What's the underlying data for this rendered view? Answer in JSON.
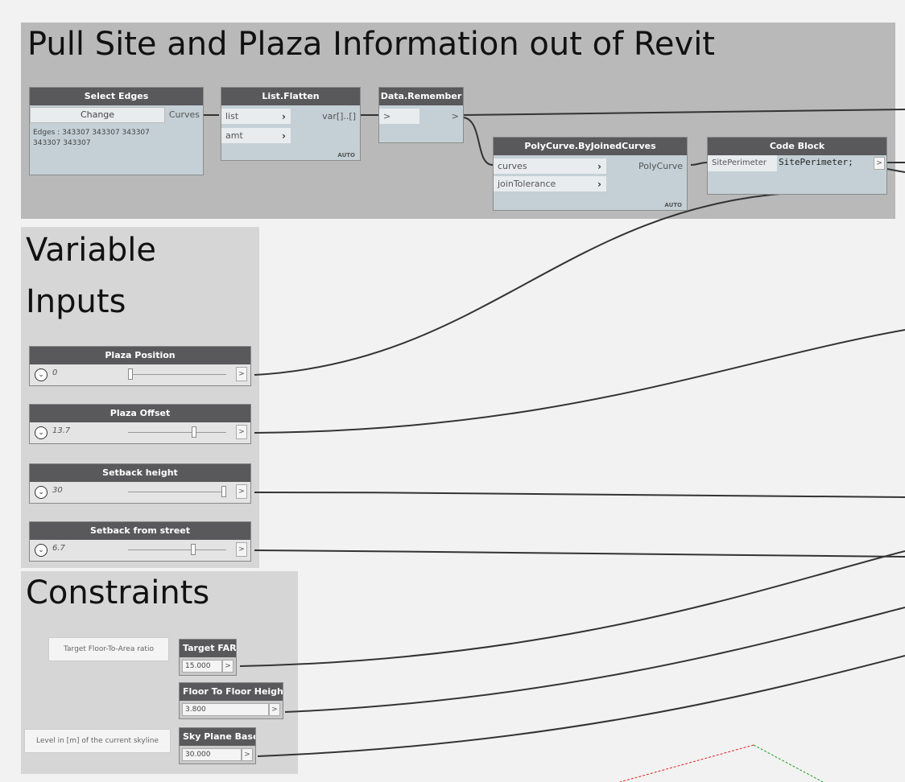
{
  "groups": {
    "pull": {
      "title": "Pull Site and Plaza Information out of Revit"
    },
    "variable": {
      "title_line1": "Variable",
      "title_line2": "Inputs"
    },
    "constraints": {
      "title": "Constraints"
    }
  },
  "nodes": {
    "select_edges": {
      "title": "Select Edges",
      "change_label": "Change",
      "output": "Curves",
      "info": "Edges : 343307 343307 343307 343307 343307"
    },
    "list_flatten": {
      "title": "List.Flatten",
      "inputs": [
        "list",
        "amt"
      ],
      "output": "var[]..[]",
      "lacing": "AUTO"
    },
    "data_remember": {
      "title": "Data.Remember",
      "input": ">",
      "output": ">"
    },
    "polycurve": {
      "title": "PolyCurve.ByJoinedCurves",
      "inputs": [
        "curves",
        "joinTolerance"
      ],
      "output": "PolyCurve",
      "lacing": "AUTO"
    },
    "code_block": {
      "title": "Code Block",
      "input": "SitePerimeter",
      "code": "SitePerimeter;",
      "output": ">"
    }
  },
  "sliders": [
    {
      "title": "Plaza Position",
      "value": "0",
      "level": 0.0
    },
    {
      "title": "Plaza Offset",
      "value": "13.7",
      "level": 0.68
    },
    {
      "title": "Setback height",
      "value": "30",
      "level": 1.0
    },
    {
      "title": "Setback from street",
      "value": "6.7",
      "level": 0.67
    }
  ],
  "constraints": {
    "target_far": {
      "title": "Target FAR",
      "value": "15.000"
    },
    "floor_height": {
      "title": "Floor To Floor Height",
      "value": "3.800"
    },
    "sky_plane": {
      "title": "Sky Plane Base",
      "value": "30.000"
    },
    "note_far": "Target Floor-To-Area ratio",
    "note_sky": "Level in [m] of the current skyline"
  },
  "port_symbol": ">",
  "colors": {
    "node_header": "#59585a",
    "group_gray": "#b9b9b9",
    "wire": "#333333",
    "axis_x": "#e02020",
    "axis_y": "#20a020"
  }
}
